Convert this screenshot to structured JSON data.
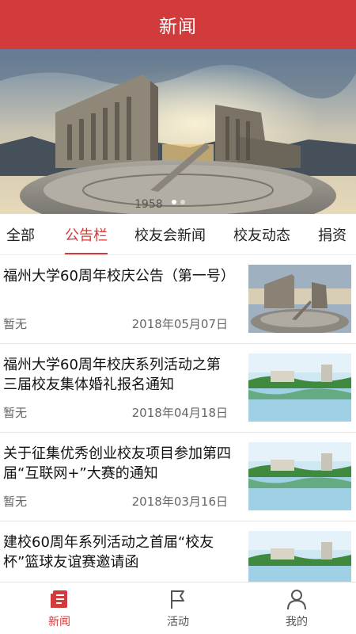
{
  "header": {
    "title": "新闻"
  },
  "banner": {
    "image": "campus-sundial-photo",
    "dots": 2,
    "active_dot": 0
  },
  "tabs": [
    {
      "label": "全部",
      "active": false
    },
    {
      "label": "公告栏",
      "active": true
    },
    {
      "label": "校友会新闻",
      "active": false
    },
    {
      "label": "校友动态",
      "active": false
    },
    {
      "label": "捐资",
      "active": false
    }
  ],
  "news": [
    {
      "title": "福州大学60周年校庆公告（第一号）",
      "author": "暂无",
      "date": "2018年05月07日",
      "thumb": "sundial-thumbnail"
    },
    {
      "title": "福州大学60周年校庆系列活动之第三届校友集体婚礼报名通知",
      "author": "暂无",
      "date": "2018年04月18日",
      "thumb": "lake-campus-thumbnail"
    },
    {
      "title": "关于征集优秀创业校友项目参加第四届“互联网+”大赛的通知",
      "author": "暂无",
      "date": "2018年03月16日",
      "thumb": "lake-campus-thumbnail"
    },
    {
      "title": "建校60周年系列活动之首届“校友杯”篮球友谊赛邀请函",
      "author": "",
      "date": "",
      "thumb": "lake-campus-thumbnail"
    }
  ],
  "bottom_nav": [
    {
      "label": "新闻",
      "icon": "news-icon",
      "active": true
    },
    {
      "label": "活动",
      "icon": "flag-icon",
      "active": false
    },
    {
      "label": "我的",
      "icon": "user-icon",
      "active": false
    }
  ],
  "colors": {
    "accent": "#d23b3b",
    "text": "#111111",
    "muted": "#666666"
  }
}
